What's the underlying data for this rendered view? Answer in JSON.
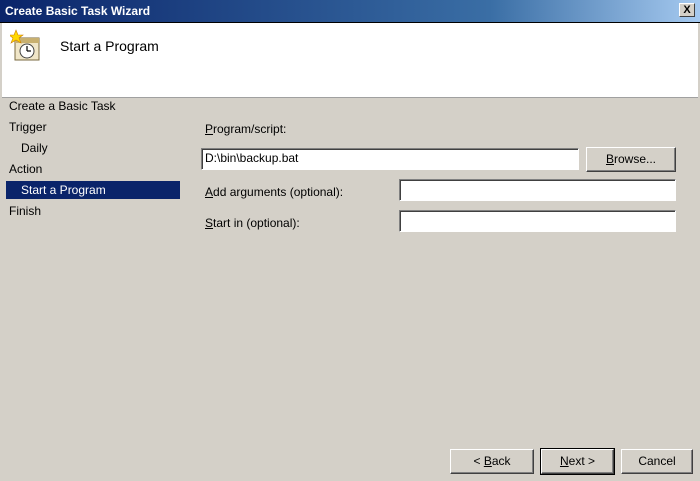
{
  "window": {
    "title": "Create Basic Task Wizard",
    "close_label": "X"
  },
  "header": {
    "title": "Start a Program",
    "icon": "task-scheduler-icon"
  },
  "sidebar": {
    "items": [
      {
        "label": "Create a Basic Task"
      },
      {
        "label": "Trigger"
      },
      {
        "label": "Daily"
      },
      {
        "label": "Action"
      },
      {
        "label": "Start a Program"
      },
      {
        "label": "Finish"
      }
    ],
    "selected": "Start a Program"
  },
  "form": {
    "program_label_prefix": "P",
    "program_label_rest": "rogram/script:",
    "program_value": "D:\\bin\\backup.bat",
    "browse_label_prefix": "B",
    "browse_label_rest": "rowse...",
    "args_label_prefix": "A",
    "args_label_rest": "dd arguments (optional):",
    "args_value": "",
    "startin_label_prefix": "S",
    "startin_label_rest": "tart in (optional):",
    "startin_value": ""
  },
  "footer": {
    "back_prefix": "< ",
    "back_accel": "B",
    "back_rest": "ack",
    "next_accel": "N",
    "next_rest": "ext >",
    "cancel_label": "Cancel"
  },
  "colors": {
    "selection": "#0a246a",
    "dialog_bg": "#d4d0c8"
  }
}
